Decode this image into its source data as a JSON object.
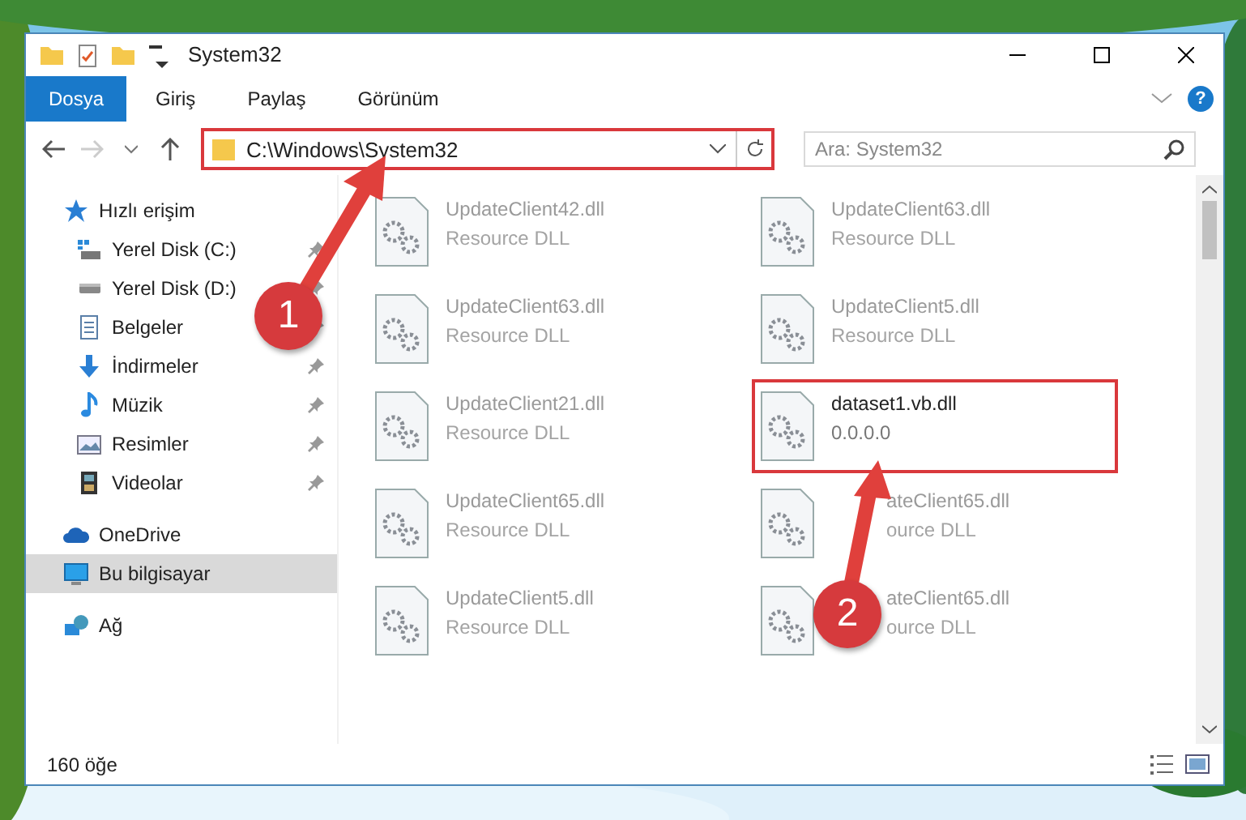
{
  "window": {
    "title": "System32"
  },
  "ribbon": {
    "tabs": [
      {
        "label": "Dosya",
        "selected": true
      },
      {
        "label": "Giriş",
        "selected": false
      },
      {
        "label": "Paylaş",
        "selected": false
      },
      {
        "label": "Görünüm",
        "selected": false
      }
    ],
    "help": "?"
  },
  "address": {
    "path": "C:\\Windows\\System32",
    "highlighted": true
  },
  "search": {
    "placeholder": "Ara: System32"
  },
  "sidebar": {
    "items": [
      {
        "label": "Hızlı erişim",
        "kind": "star",
        "selected": false,
        "children": [
          {
            "label": "Yerel Disk (C:)",
            "kind": "windrive",
            "pinned": true
          },
          {
            "label": "Yerel Disk (D:)",
            "kind": "drive",
            "pinned": true
          },
          {
            "label": "Belgeler",
            "kind": "docs",
            "pinned": true
          },
          {
            "label": "İndirmeler",
            "kind": "download",
            "pinned": true
          },
          {
            "label": "Müzik",
            "kind": "music",
            "pinned": true
          },
          {
            "label": "Resimler",
            "kind": "pictures",
            "pinned": true
          },
          {
            "label": "Videolar",
            "kind": "videos",
            "pinned": true
          }
        ]
      },
      {
        "label": "OneDrive",
        "kind": "cloud",
        "selected": false
      },
      {
        "label": "Bu bilgisayar",
        "kind": "computer",
        "selected": true
      },
      {
        "label": "Ağ",
        "kind": "network",
        "selected": false
      }
    ]
  },
  "files": [
    {
      "name": "UpdateClient42.dll",
      "detail": "Resource DLL",
      "faded": true,
      "highlighted": false
    },
    {
      "name": "UpdateClient63.dll",
      "detail": "Resource DLL",
      "faded": true,
      "highlighted": false
    },
    {
      "name": "UpdateClient63.dll",
      "detail": "Resource DLL",
      "faded": true,
      "highlighted": false
    },
    {
      "name": "UpdateClient5.dll",
      "detail": "Resource DLL",
      "faded": true,
      "highlighted": false
    },
    {
      "name": "UpdateClient21.dll",
      "detail": "Resource DLL",
      "faded": true,
      "highlighted": false
    },
    {
      "name": "dataset1.vb.dll",
      "detail": "0.0.0.0",
      "faded": false,
      "highlighted": true
    },
    {
      "name": "UpdateClient65.dll",
      "detail": "Resource DLL",
      "faded": true,
      "highlighted": false
    },
    {
      "name": "ateClient65.dll",
      "detail": "ource DLL",
      "faded": true,
      "highlighted": false,
      "covered": true
    },
    {
      "name": "UpdateClient5.dll",
      "detail": "Resource DLL",
      "faded": true,
      "highlighted": false
    },
    {
      "name": "ateClient65.dll",
      "detail": "ource DLL",
      "faded": true,
      "highlighted": false,
      "covered": true
    }
  ],
  "status_bar": {
    "count": "160 öğe"
  },
  "callouts": [
    {
      "label": "1"
    },
    {
      "label": "2"
    }
  ]
}
